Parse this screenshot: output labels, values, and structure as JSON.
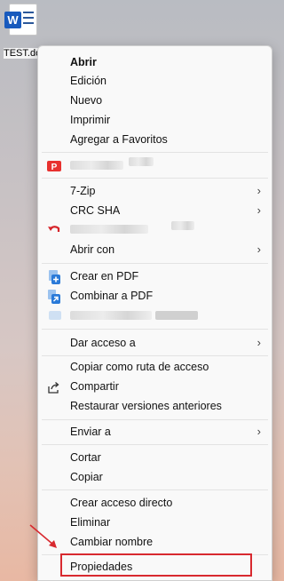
{
  "desktop": {
    "file_label": "TEST.docx",
    "app_badge": "W"
  },
  "menu": {
    "items": {
      "abrir": "Abrir",
      "edicion": "Edición",
      "nuevo": "Nuevo",
      "imprimir": "Imprimir",
      "agregar_favoritos": "Agregar a Favoritos",
      "sevenzip": "7-Zip",
      "crc_sha": "CRC SHA",
      "abrir_con": "Abrir con",
      "crear_pdf": "Crear en PDF",
      "combinar_pdf": "Combinar a PDF",
      "dar_acceso": "Dar acceso a",
      "copiar_ruta": "Copiar como ruta de acceso",
      "compartir": "Compartir",
      "restaurar": "Restaurar versiones anteriores",
      "enviar_a": "Enviar a",
      "cortar": "Cortar",
      "copiar": "Copiar",
      "crear_acceso": "Crear acceso directo",
      "eliminar": "Eliminar",
      "cambiar_nombre": "Cambiar nombre",
      "propiedades": "Propiedades"
    },
    "chevron": "›",
    "icons": {
      "pdf_app": "pdf-app-icon",
      "undo": "undo-arrow-icon",
      "create_pdf": "create-pdf-icon",
      "combine_pdf": "combine-pdf-icon",
      "share": "share-icon"
    }
  },
  "colors": {
    "highlight_border": "#d8292f",
    "word_blue": "#185abd",
    "pdf_red": "#e8312f",
    "pdf_blue": "#2a7ad8"
  }
}
